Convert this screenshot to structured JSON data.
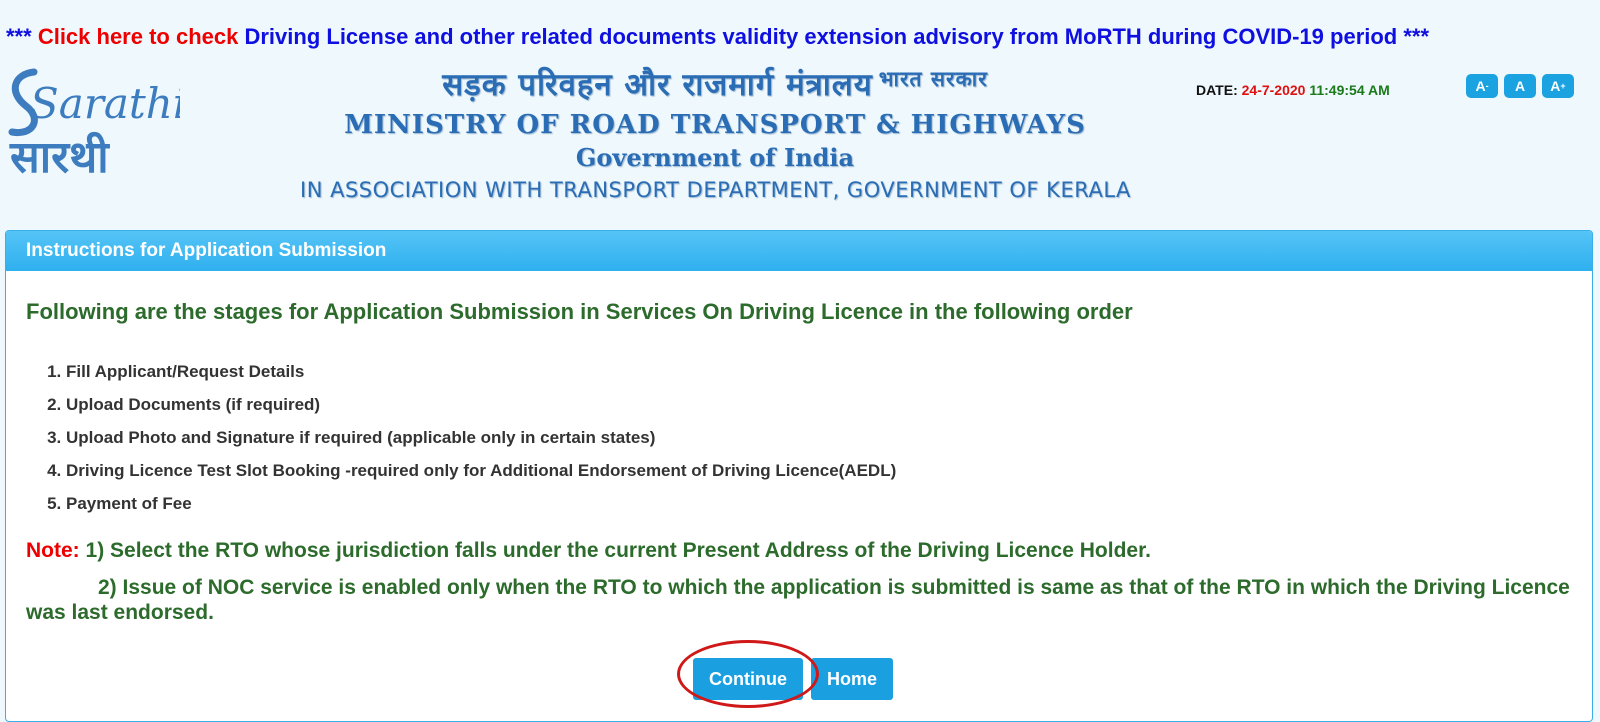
{
  "advisory": {
    "prefix": "***",
    "link_text": "Click here to check",
    "message": "Driving License and other related documents validity extension advisory from MoRTH during COVID-19 period",
    "suffix": "***"
  },
  "logo": {
    "line1": "Sarathi",
    "line2": "सारथी"
  },
  "header": {
    "hindi_title": "सड़क परिवहन और राजमार्ग मंत्रालय",
    "hindi_superscript": "भारत सरकार",
    "ministry_name": "MINISTRY OF ROAD TRANSPORT & HIGHWAYS",
    "government": "Government of India",
    "association": "IN ASSOCIATION WITH TRANSPORT DEPARTMENT, GOVERNMENT OF KERALA"
  },
  "datetime": {
    "label": "DATE:",
    "date": "24-7-2020",
    "time": "11:49:54 AM"
  },
  "font_controls": {
    "decrease": {
      "label": "A",
      "sup": "-"
    },
    "normal": {
      "label": "A"
    },
    "increase": {
      "label": "A",
      "sup": "+"
    }
  },
  "panel": {
    "title": "Instructions for Application Submission",
    "intro": "Following are the stages for Application Submission in Services On Driving Licence in the following order",
    "steps": [
      "Fill Applicant/Request Details",
      "Upload Documents (if required)",
      "Upload Photo and Signature if required (applicable only in certain states)",
      "Driving Licence Test Slot Booking -required only for Additional Endorsement of Driving Licence(AEDL)",
      "Payment of Fee"
    ],
    "note_label": "Note:",
    "note_1": "1) Select the RTO whose jurisdiction falls under the current Present Address of the Driving Licence Holder.",
    "note_2": "2) Issue of NOC service is enabled only when the RTO to which the application is submitted is same as that of the RTO in which the Driving Licence was last endorsed."
  },
  "actions": {
    "continue_label": "Continue",
    "home_label": "Home"
  },
  "colors": {
    "page_background": "#eef8fd",
    "advisory_blue": "#0f0fe0",
    "alert_red": "#ee0000",
    "heading_blue": "#2a6db5",
    "accent_blue": "#1a9fe0",
    "instruction_green": "#2c6b2c",
    "annotation_red": "#d01818"
  }
}
